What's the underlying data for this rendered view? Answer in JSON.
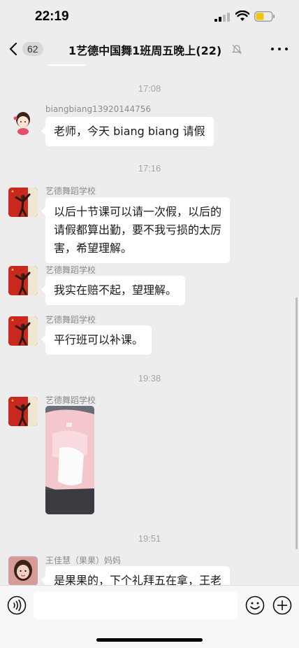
{
  "status": {
    "time": "22:19"
  },
  "nav": {
    "unread_count": "62",
    "title": "1艺德中国舞1班周五晚上(22)"
  },
  "messages": [
    {
      "kind": "time",
      "text": "17:08"
    },
    {
      "kind": "msg",
      "sender": "biangbiang13920144756",
      "text": "老师，今天 biang biang 请假",
      "avatar": "cartoon-girl-avatar"
    },
    {
      "kind": "time",
      "text": "17:16"
    },
    {
      "kind": "msg",
      "sender": "艺德舞蹈学校",
      "lines": [
        "以后十节课可以请一次假，以后的",
        "请假都算出勤，要不我亏损的太厉",
        "害，希望理解。"
      ],
      "avatar": "dancer-flag-avatar"
    },
    {
      "kind": "msg",
      "sender": "艺德舞蹈学校",
      "text": "我实在赔不起，望理解。",
      "avatar": "dancer-flag-avatar"
    },
    {
      "kind": "msg",
      "sender": "艺德舞蹈学校",
      "text": "平行班可以补课。",
      "avatar": "dancer-flag-avatar"
    },
    {
      "kind": "time",
      "text": "19:38"
    },
    {
      "kind": "image",
      "sender": "艺德舞蹈学校",
      "avatar": "dancer-flag-avatar",
      "image": "pink-clothing-photo"
    },
    {
      "kind": "time",
      "text": "19:51"
    },
    {
      "kind": "msg",
      "sender": "王佳慧（果果）妈妈",
      "text": "是果果的，下个礼拜五在拿，王老",
      "avatar": "girl-photo-avatar"
    }
  ],
  "input": {
    "placeholder": ""
  },
  "colors": {
    "background": "#ededed",
    "bubble": "#ffffff",
    "meta_text": "#a6a6a6"
  }
}
